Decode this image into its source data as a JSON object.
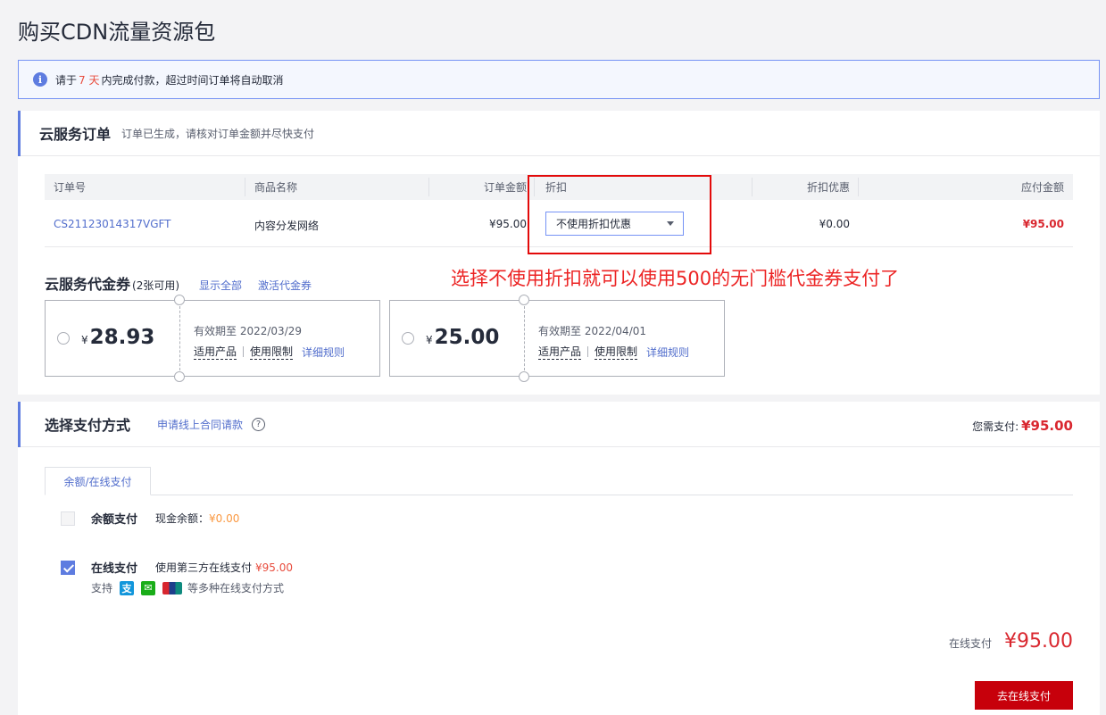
{
  "page": {
    "title": "购买CDN流量资源包"
  },
  "notice": {
    "prefix": "请于",
    "days": "7 天",
    "suffix": "内完成付款，超过时间订单将自动取消"
  },
  "order_section": {
    "title": "云服务订单",
    "subtitle": "订单已生成，请核对订单金额并尽快支付",
    "columns": [
      "订单号",
      "商品名称",
      "订单金额",
      "折扣",
      "折扣优惠",
      "应付金额"
    ],
    "row": {
      "order_no": "CS21123014317VGFT",
      "product": "内容分发网络",
      "amount": "¥95.00",
      "discount_select": "不使用折扣优惠",
      "discount_value": "¥0.00",
      "payable": "¥95.00"
    }
  },
  "annotation": {
    "text": "选择不使用折扣就可以使用500的无门槛代金券支付了",
    "color": "#ec2424"
  },
  "voucher_section": {
    "title": "云服务代金券",
    "count": "(2张可用)",
    "show_all": "显示全部",
    "activate": "激活代金券",
    "coupons": [
      {
        "yen": "¥",
        "amount": "28.93",
        "validity_label": "有效期至",
        "validity": "2022/03/29",
        "product": "适用产品",
        "limit": "使用限制",
        "rule": "详细规则"
      },
      {
        "yen": "¥",
        "amount": "25.00",
        "validity_label": "有效期至",
        "validity": "2022/04/01",
        "product": "适用产品",
        "limit": "使用限制",
        "rule": "详细规则"
      }
    ]
  },
  "payment_section": {
    "title": "选择支付方式",
    "contract_link": "申请线上合同请款",
    "need_pay_label": "您需支付:",
    "need_pay_value": "¥95.00",
    "tab": "余额/在线支付",
    "balance": {
      "title": "余额支付",
      "desc": "现金余额：",
      "value": "¥0.00",
      "checked": false
    },
    "online": {
      "title": "在线支付",
      "desc": "使用第三方在线支付",
      "value": "¥95.00",
      "checked": true
    },
    "support_label": "支持",
    "support_more": "等多种在线支付方式",
    "total_label": "在线支付",
    "total_value": "¥95.00",
    "button": "去在线支付"
  },
  "colors": {
    "accent": "#5e7ce0",
    "price_red": "#d9272f",
    "button_red": "#c7000b",
    "annotation_box": "#e30a0a"
  }
}
